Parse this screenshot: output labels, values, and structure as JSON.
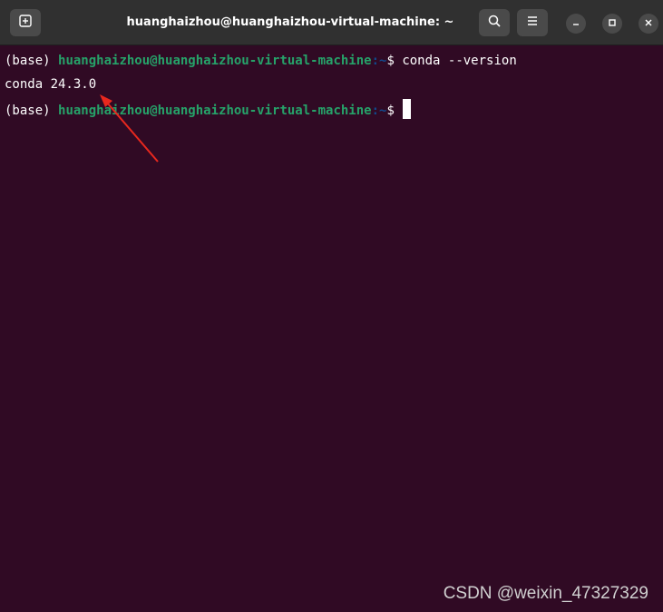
{
  "window": {
    "title": "huanghaizhou@huanghaizhou-virtual-machine: ~"
  },
  "headerbar": {
    "new_tab_icon": "new-tab-icon",
    "search_icon": "search-icon",
    "menu_icon": "hamburger-menu-icon",
    "minimize_icon": "minimize-icon",
    "maximize_icon": "maximize-icon",
    "close_icon": "close-icon"
  },
  "terminal": {
    "lines": [
      {
        "env": "(base) ",
        "user_host": "huanghaizhou@huanghaizhou-virtual-machine",
        "path": ":~",
        "prompt": "$ ",
        "command": "conda --version"
      },
      {
        "output": "conda 24.3.0"
      },
      {
        "env": "(base) ",
        "user_host": "huanghaizhou@huanghaizhou-virtual-machine",
        "path": ":~",
        "prompt": "$ ",
        "command": ""
      }
    ]
  },
  "annotation": {
    "arrow_color": "#e8281e"
  },
  "watermark": "CSDN @weixin_47327329",
  "colors": {
    "terminal_bg": "#300a24",
    "headerbar_bg": "#303030",
    "user_host": "#26a269",
    "path": "#12488b"
  }
}
